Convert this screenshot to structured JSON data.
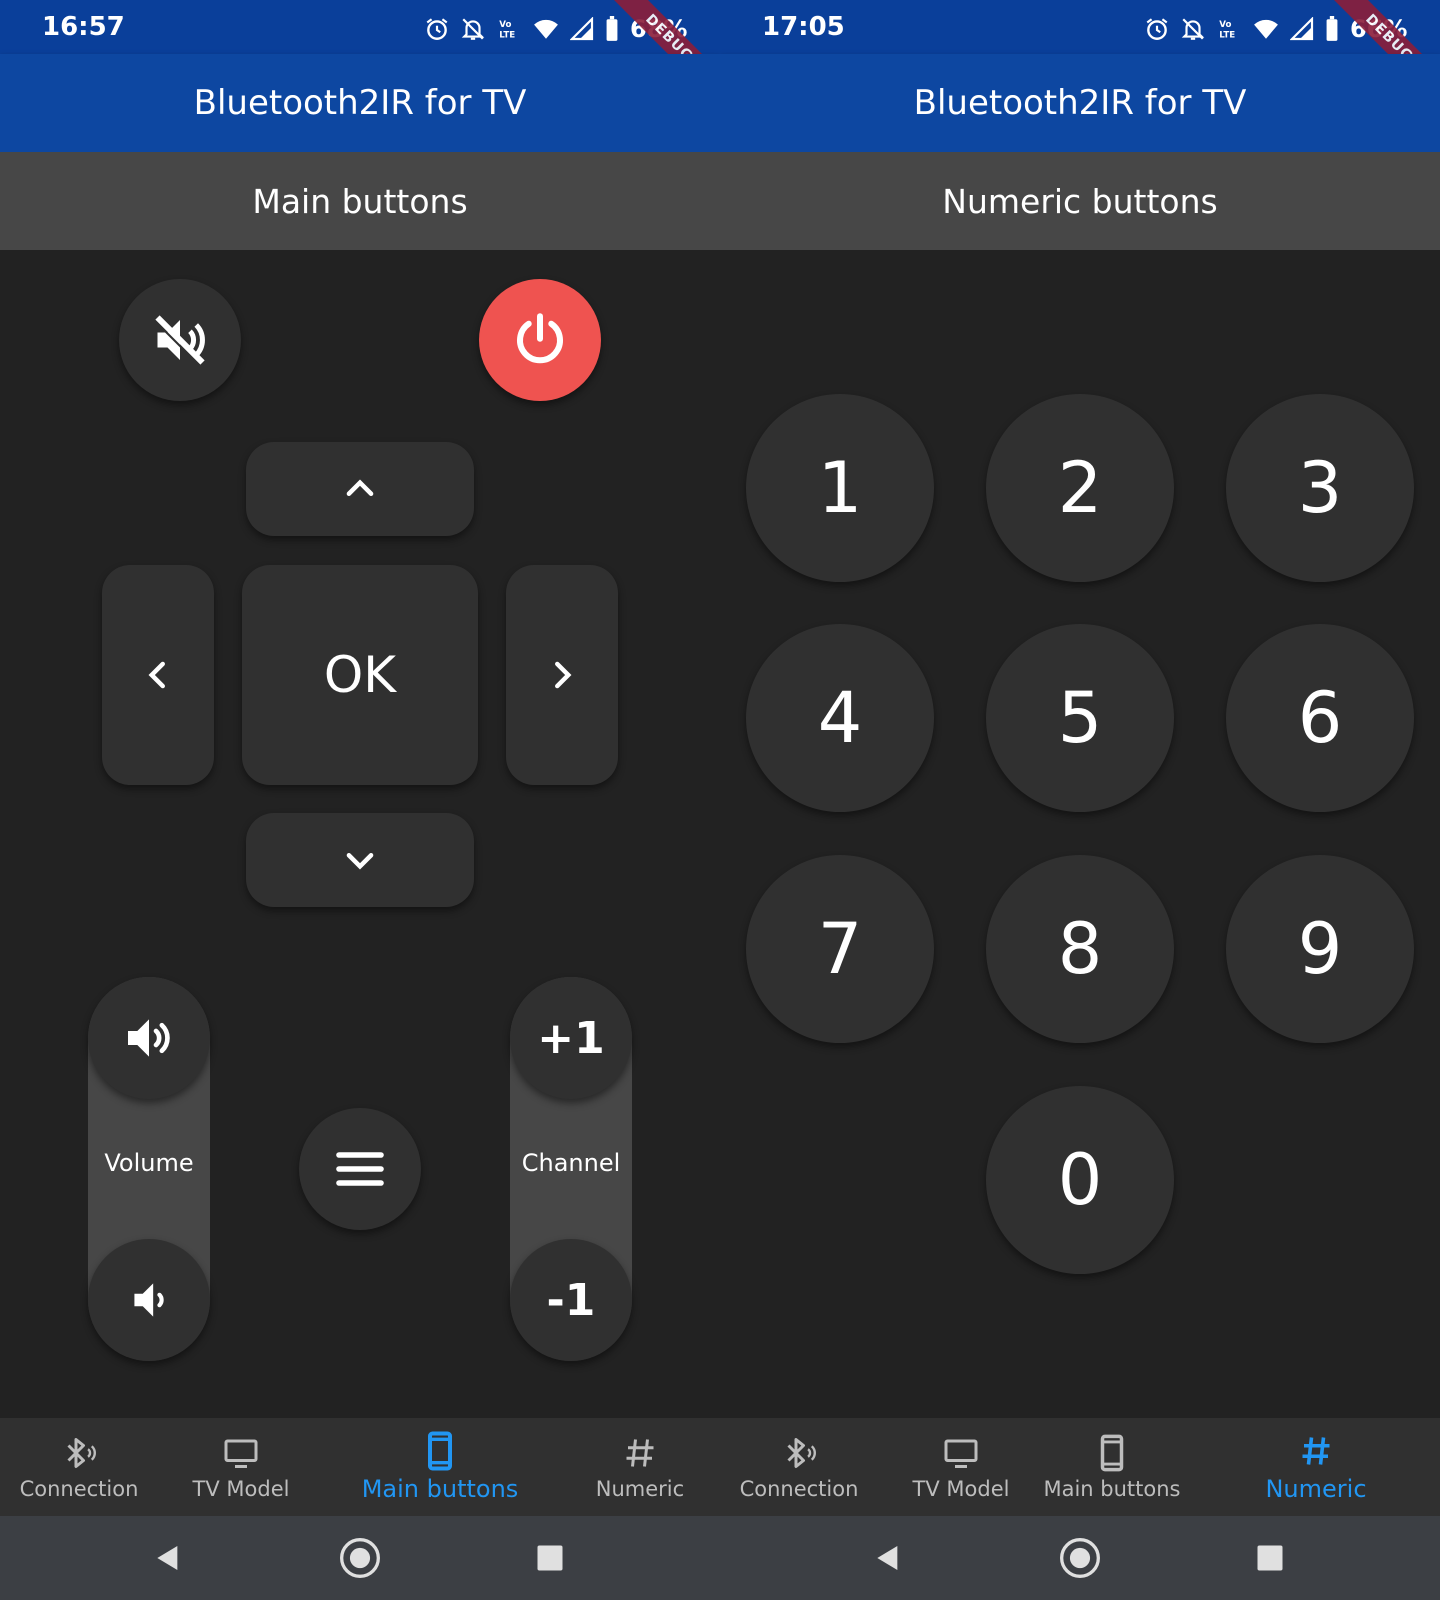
{
  "app": {
    "title": "Bluetooth2IR for TV"
  },
  "debug_banner": "DEBUG",
  "accent_color": "#2196f3",
  "power_color": "#ef5350",
  "left": {
    "status": {
      "time": "16:57",
      "battery": "68%"
    },
    "page_title": "Main buttons",
    "remote": {
      "ok_label": "OK",
      "volume_label": "Volume",
      "channel_label": "Channel",
      "channel_up_label": "+1",
      "channel_down_label": "-1",
      "icons": [
        "mute-icon",
        "power-icon",
        "chevron-up-icon",
        "chevron-left-icon",
        "chevron-right-icon",
        "chevron-down-icon",
        "volume-up-icon",
        "volume-down-icon",
        "menu-icon"
      ]
    },
    "nav": [
      {
        "label": "Connection",
        "icon": "bluetooth-audio-icon",
        "active": false
      },
      {
        "label": "TV Model",
        "icon": "tv-icon",
        "active": false
      },
      {
        "label": "Main buttons",
        "icon": "phone-icon",
        "active": true
      },
      {
        "label": "Numeric",
        "icon": "hash-icon",
        "active": false
      }
    ]
  },
  "right": {
    "status": {
      "time": "17:05",
      "battery": "66%"
    },
    "page_title": "Numeric buttons",
    "numbers": [
      "1",
      "2",
      "3",
      "4",
      "5",
      "6",
      "7",
      "8",
      "9",
      "0"
    ],
    "nav": [
      {
        "label": "Connection",
        "icon": "bluetooth-audio-icon",
        "active": false
      },
      {
        "label": "TV Model",
        "icon": "tv-icon",
        "active": false
      },
      {
        "label": "Main buttons",
        "icon": "phone-icon",
        "active": false
      },
      {
        "label": "Numeric",
        "icon": "hash-icon",
        "active": true
      }
    ]
  }
}
